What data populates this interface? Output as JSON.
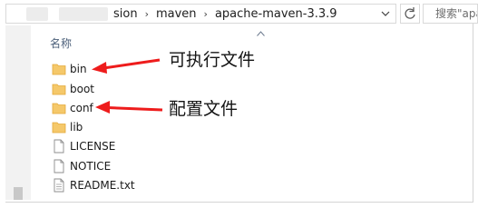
{
  "address_bar": {
    "crumbs": [
      "sion",
      "maven",
      "apache-maven-3.3.9"
    ],
    "separator": "›"
  },
  "search": {
    "placeholder": "搜索\"apa"
  },
  "list": {
    "column_header": "名称",
    "files": [
      {
        "name": "bin",
        "type": "folder"
      },
      {
        "name": "boot",
        "type": "folder"
      },
      {
        "name": "conf",
        "type": "folder"
      },
      {
        "name": "lib",
        "type": "folder"
      },
      {
        "name": "LICENSE",
        "type": "file"
      },
      {
        "name": "NOTICE",
        "type": "file"
      },
      {
        "name": "README.txt",
        "type": "file"
      }
    ]
  },
  "annotations": {
    "executable": "可执行文件",
    "config": "配置文件",
    "arrow_color": "#ee1c1c"
  },
  "colors": {
    "folder": "#f5c86a",
    "folder_dark": "#e4a93a",
    "header_text": "#4c607a"
  }
}
